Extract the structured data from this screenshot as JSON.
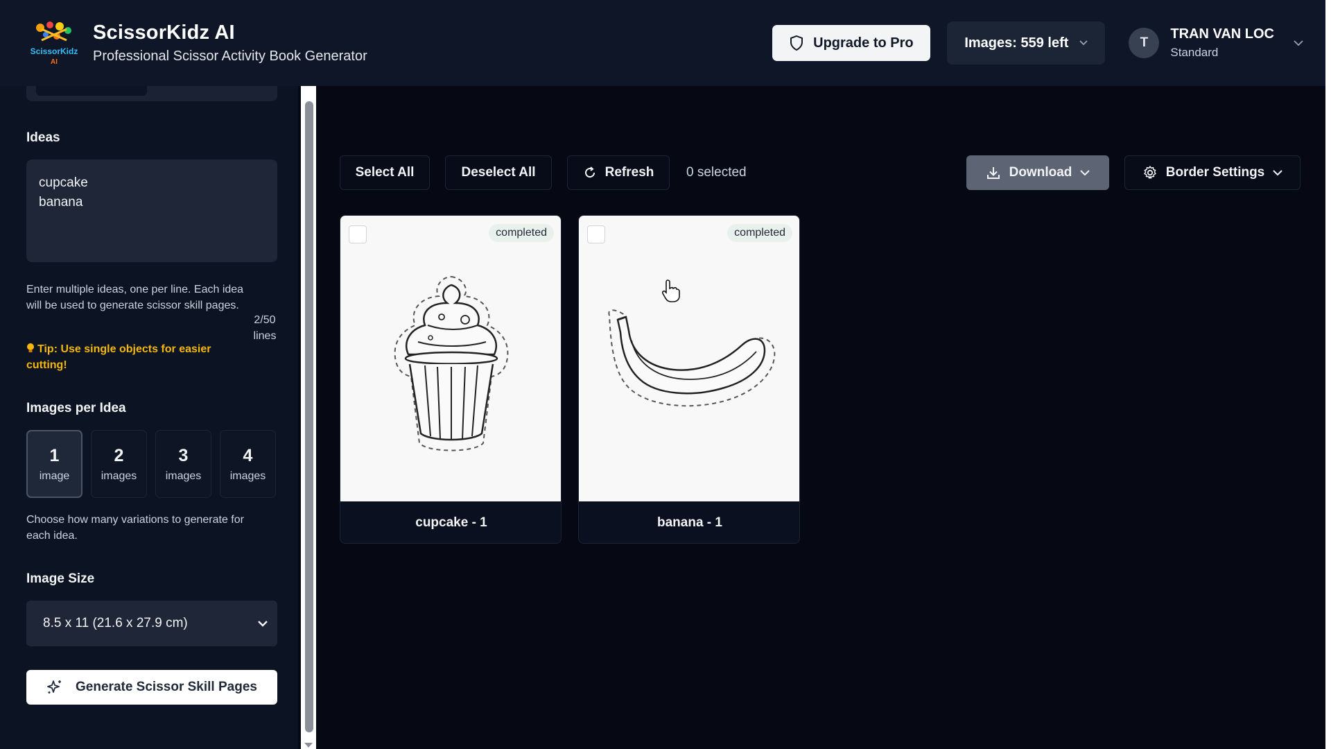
{
  "header": {
    "brand_title": "ScissorKidz AI",
    "brand_subtitle": "Professional Scissor Activity Book Generator",
    "logo_text": "ScissorKidz AI",
    "upgrade_label": "Upgrade to Pro",
    "images_left_label": "Images: 559 left",
    "user": {
      "initial": "T",
      "name": "TRAN VAN LOC",
      "plan": "Standard"
    }
  },
  "sidebar": {
    "ideas_heading": "Ideas",
    "ideas_value": "cupcake\nbanana",
    "ideas_help": "Enter multiple ideas, one per line. Each idea will be used to generate scissor skill pages.",
    "line_count": "2/50",
    "line_count_unit": "lines",
    "tip": "Tip: Use single objects for easier cutting!",
    "images_per_idea_heading": "Images per Idea",
    "images_per_idea_options": [
      {
        "num": "1",
        "unit": "image",
        "selected": true
      },
      {
        "num": "2",
        "unit": "images",
        "selected": false
      },
      {
        "num": "3",
        "unit": "images",
        "selected": false
      },
      {
        "num": "4",
        "unit": "images",
        "selected": false
      }
    ],
    "images_per_idea_help": "Choose how many variations to generate for each idea.",
    "image_size_heading": "Image Size",
    "image_size_value": "8.5 x 11 (21.6 x 27.9 cm)",
    "generate_label": "Generate Scissor Skill Pages"
  },
  "toolbar": {
    "select_all": "Select All",
    "deselect_all": "Deselect All",
    "refresh": "Refresh",
    "selected_count": "0 selected",
    "download": "Download",
    "border_settings": "Border Settings"
  },
  "cards": [
    {
      "label": "cupcake - 1",
      "status": "completed",
      "icon": "cupcake-illustration",
      "checked": false
    },
    {
      "label": "banana - 1",
      "status": "completed",
      "icon": "banana-illustration",
      "checked": false
    }
  ],
  "colors": {
    "background": "#060914",
    "header": "#0e1628",
    "sidebar": "#0c1322",
    "tip": "#f5b70a",
    "badge": "#e8f1ec"
  }
}
